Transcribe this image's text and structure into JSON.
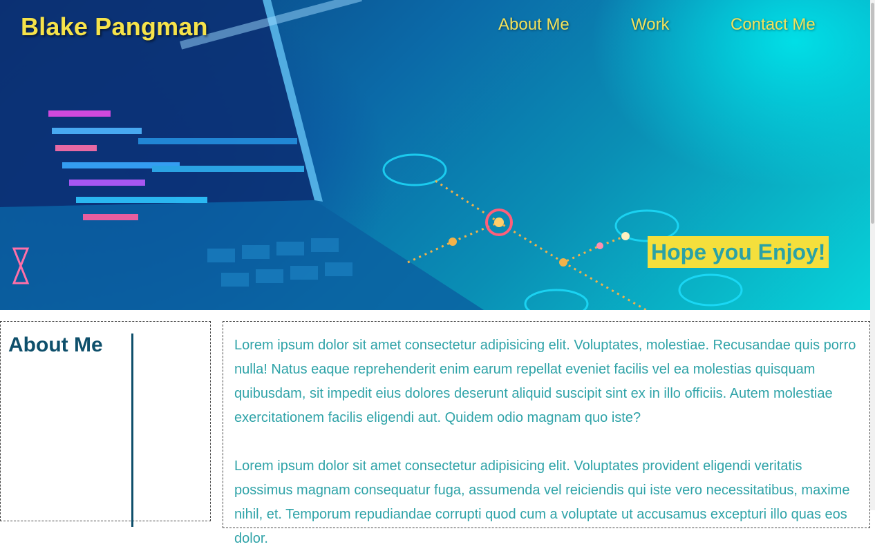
{
  "header": {
    "brand": "Blake Pangman",
    "nav": [
      {
        "label": "About Me"
      },
      {
        "label": "Work"
      },
      {
        "label": "Contact Me"
      }
    ],
    "tagline": "Hope you Enjoy!"
  },
  "about": {
    "heading": "About Me",
    "paragraphs": [
      "Lorem ipsum dolor sit amet consectetur adipisicing elit. Voluptates, molestiae. Recusandae quis porro nulla! Natus eaque reprehenderit enim earum repellat eveniet facilis vel ea molestias quisquam quibusdam, sit impedit eius dolores deserunt aliquid suscipit sint ex in illo officiis. Autem molestiae exercitationem facilis eligendi aut. Quidem odio magnam quo iste?",
      "Lorem ipsum dolor sit amet consectetur adipisicing elit. Voluptates provident eligendi veritatis possimus magnam consequatur fuga, assumenda vel reiciendis qui iste vero necessitatibus, maxime nihil, et. Temporum repudiandae corrupti quod cum a voluptate ut accusamus excepturi illo quas eos dolor."
    ]
  },
  "colors": {
    "accent_yellow": "#f4df3c",
    "heading_blue": "#0e4f6b",
    "body_teal": "#2fa3a8"
  }
}
